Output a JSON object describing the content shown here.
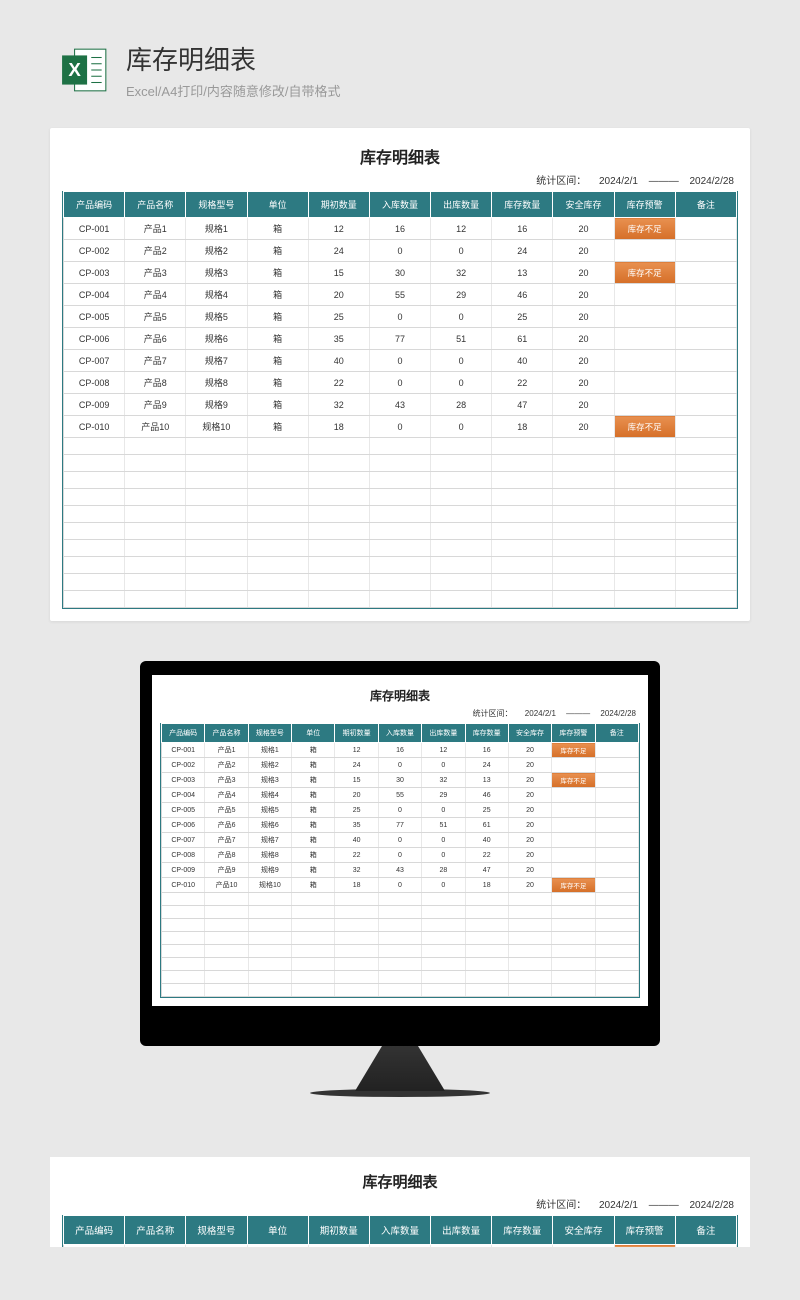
{
  "header": {
    "title": "库存明细表",
    "subtitle": "Excel/A4打印/内容随意修改/自带格式"
  },
  "sheet": {
    "title": "库存明细表",
    "stat_label": "统计区间：",
    "date_from": "2024/2/1",
    "date_to": "2024/2/28",
    "columns": [
      "产品编码",
      "产品名称",
      "规格型号",
      "单位",
      "期初数量",
      "入库数量",
      "出库数量",
      "库存数量",
      "安全库存",
      "库存预警",
      "备注"
    ],
    "rows": [
      {
        "code": "CP-001",
        "name": "产品1",
        "spec": "规格1",
        "unit": "箱",
        "open": "12",
        "in": "16",
        "out": "12",
        "stock": "16",
        "safe": "20",
        "warn": "库存不足",
        "remark": ""
      },
      {
        "code": "CP-002",
        "name": "产品2",
        "spec": "规格2",
        "unit": "箱",
        "open": "24",
        "in": "0",
        "out": "0",
        "stock": "24",
        "safe": "20",
        "warn": "",
        "remark": ""
      },
      {
        "code": "CP-003",
        "name": "产品3",
        "spec": "规格3",
        "unit": "箱",
        "open": "15",
        "in": "30",
        "out": "32",
        "stock": "13",
        "safe": "20",
        "warn": "库存不足",
        "remark": ""
      },
      {
        "code": "CP-004",
        "name": "产品4",
        "spec": "规格4",
        "unit": "箱",
        "open": "20",
        "in": "55",
        "out": "29",
        "stock": "46",
        "safe": "20",
        "warn": "",
        "remark": ""
      },
      {
        "code": "CP-005",
        "name": "产品5",
        "spec": "规格5",
        "unit": "箱",
        "open": "25",
        "in": "0",
        "out": "0",
        "stock": "25",
        "safe": "20",
        "warn": "",
        "remark": ""
      },
      {
        "code": "CP-006",
        "name": "产品6",
        "spec": "规格6",
        "unit": "箱",
        "open": "35",
        "in": "77",
        "out": "51",
        "stock": "61",
        "safe": "20",
        "warn": "",
        "remark": ""
      },
      {
        "code": "CP-007",
        "name": "产品7",
        "spec": "规格7",
        "unit": "箱",
        "open": "40",
        "in": "0",
        "out": "0",
        "stock": "40",
        "safe": "20",
        "warn": "",
        "remark": ""
      },
      {
        "code": "CP-008",
        "name": "产品8",
        "spec": "规格8",
        "unit": "箱",
        "open": "22",
        "in": "0",
        "out": "0",
        "stock": "22",
        "safe": "20",
        "warn": "",
        "remark": ""
      },
      {
        "code": "CP-009",
        "name": "产品9",
        "spec": "规格9",
        "unit": "箱",
        "open": "32",
        "in": "43",
        "out": "28",
        "stock": "47",
        "safe": "20",
        "warn": "",
        "remark": ""
      },
      {
        "code": "CP-010",
        "name": "产品10",
        "spec": "规格10",
        "unit": "箱",
        "open": "18",
        "in": "0",
        "out": "0",
        "stock": "18",
        "safe": "20",
        "warn": "库存不足",
        "remark": ""
      }
    ],
    "empty_rows": 10
  }
}
